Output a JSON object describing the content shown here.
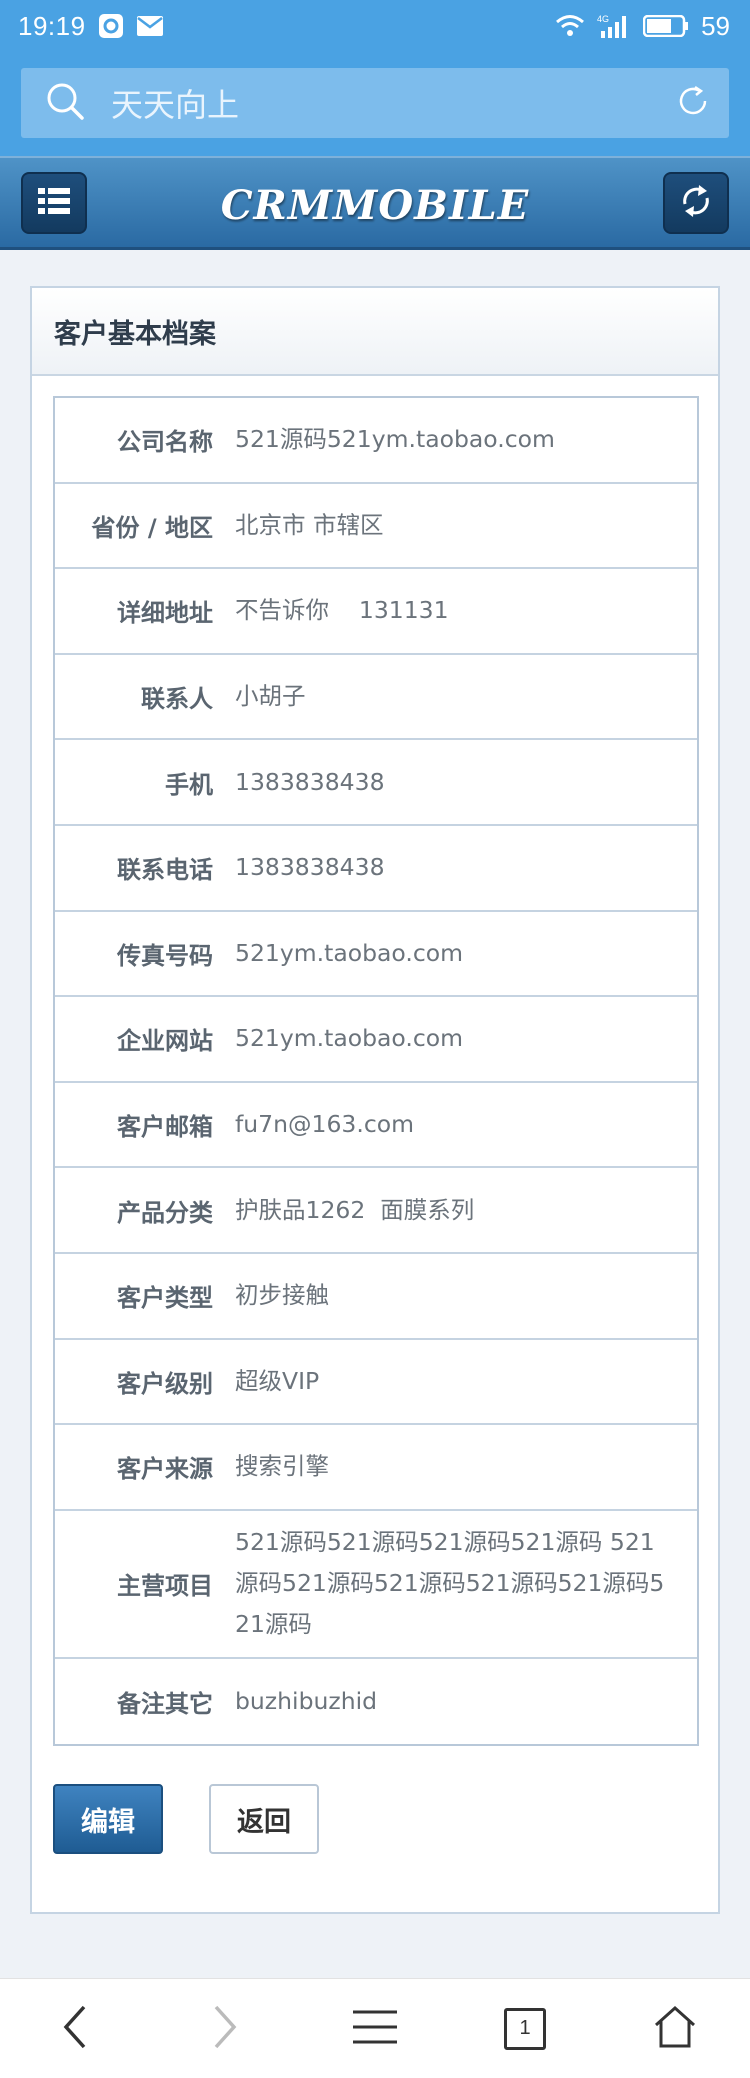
{
  "status_bar": {
    "time": "19:19",
    "network": "4G",
    "battery": "59"
  },
  "search": {
    "value": "天天向上"
  },
  "header": {
    "brand": "CRMMOBILE"
  },
  "panel": {
    "title": "客户基本档案"
  },
  "fields": [
    {
      "label": "公司名称",
      "value": "521源码521ym.taobao.com"
    },
    {
      "label": "省份 / 地区",
      "value": "北京市  市辖区"
    },
    {
      "label": "详细地址",
      "value": "不告诉你    131131"
    },
    {
      "label": "联系人",
      "value": "小胡子"
    },
    {
      "label": "手机",
      "value": "1383838438"
    },
    {
      "label": "联系电话",
      "value": "1383838438"
    },
    {
      "label": "传真号码",
      "value": "521ym.taobao.com"
    },
    {
      "label": "企业网站",
      "value": "521ym.taobao.com"
    },
    {
      "label": "客户邮箱",
      "value": "fu7n@163.com"
    },
    {
      "label": "产品分类",
      "value": "护肤品1262  面膜系列"
    },
    {
      "label": "客户类型",
      "value": "初步接触"
    },
    {
      "label": "客户级别",
      "value": "超级VIP"
    },
    {
      "label": "客户来源",
      "value": "搜索引擎"
    },
    {
      "label": "主营项目",
      "value": "521源码521源码521源码521源码 521源码521源码521源码521源码521源码521源码"
    },
    {
      "label": "备注其它",
      "value": "buzhibuzhid"
    }
  ],
  "buttons": {
    "edit": "编辑",
    "back": "返回"
  },
  "bottom_nav": {
    "tab_count": "1"
  },
  "colors": {
    "accent": "#4aa2e3",
    "header_dark": "#2a6aa3",
    "edit_button": "#2b6ea8"
  }
}
